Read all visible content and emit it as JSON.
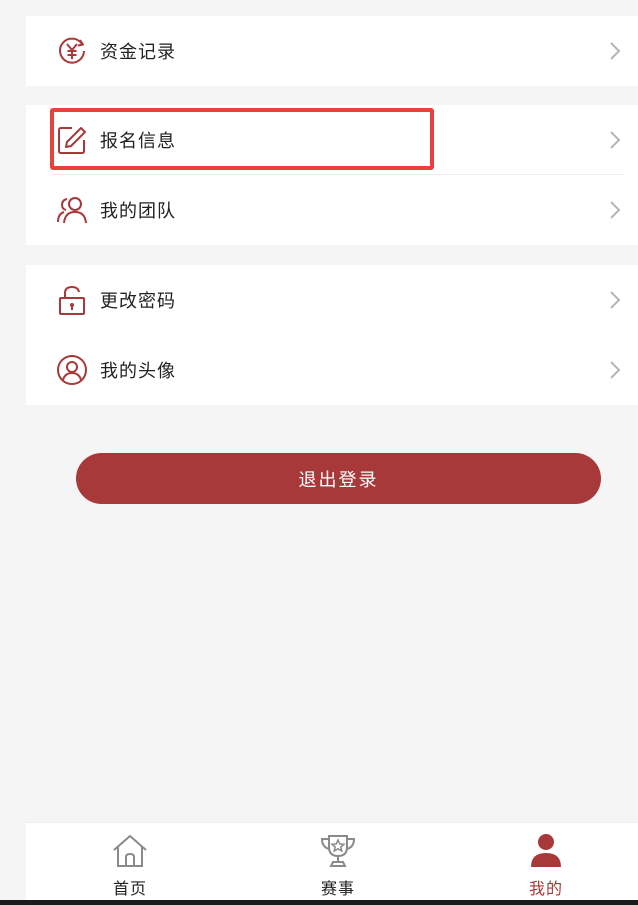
{
  "colors": {
    "accent": "#a8393a",
    "highlight": "#e8413b",
    "chevron": "#b5b5b5",
    "tab_inactive": "#8a8a8a"
  },
  "menu": {
    "group1": [
      {
        "label": "资金记录",
        "icon": "yen-coin-icon"
      }
    ],
    "group2": [
      {
        "label": "报名信息",
        "icon": "edit-note-icon"
      },
      {
        "label": "我的团队",
        "icon": "team-icon"
      }
    ],
    "group3": [
      {
        "label": "更改密码",
        "icon": "lock-icon"
      },
      {
        "label": "我的头像",
        "icon": "avatar-icon"
      }
    ]
  },
  "logout_label": "退出登录",
  "tabbar": {
    "tabs": [
      {
        "label": "首页",
        "icon": "home-icon",
        "active": false
      },
      {
        "label": "赛事",
        "icon": "trophy-icon",
        "active": false
      },
      {
        "label": "我的",
        "icon": "person-icon",
        "active": true
      }
    ]
  }
}
